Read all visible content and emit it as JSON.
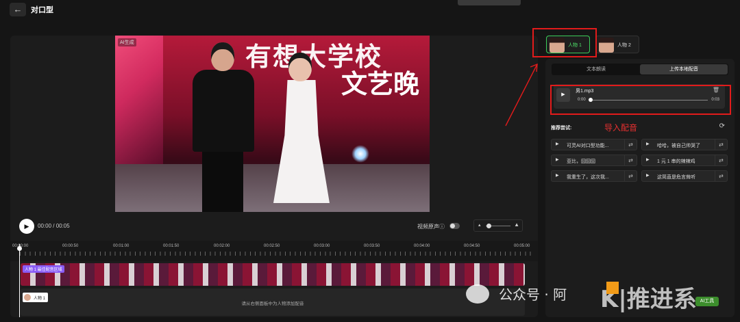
{
  "header": {
    "title": "对口型",
    "back_icon": "←"
  },
  "video": {
    "ai_tag": "AI生成",
    "stage_text_1": "有想大学校",
    "stage_text_2": "文艺晚"
  },
  "player": {
    "play_icon": "▶",
    "time": "00:00 / 00:05",
    "original_sound_label": "视频原声ⓘ",
    "zoom_out_icon": "▴",
    "zoom_in_icon": "▲"
  },
  "timeline": {
    "ticks": [
      "00:00:00",
      "00:00:50",
      "00:01:00",
      "00:01:50",
      "00:02:00",
      "00:02:50",
      "00:03:00",
      "00:03:50",
      "00:04:00",
      "00:04:50",
      "00:05:00"
    ],
    "video_track_label": "人物 1 最佳配音区域",
    "audio_person": "人物 1",
    "audio_hint": "请从右侧面板中为人物添加配音"
  },
  "characters": [
    {
      "label": "人物 1",
      "active": true
    },
    {
      "label": "人物 2",
      "active": false
    }
  ],
  "right_panel": {
    "tabs": [
      "文本朗读",
      "上传本地配音"
    ],
    "active_tab": "上传本地配音",
    "audio_file": {
      "name": "男1.mp3",
      "current": "0:00",
      "duration": "0:03",
      "progress": 0,
      "delete_icon": "🗑"
    },
    "recommend_title": "推荐尝试:",
    "import_annotation": "导入配音",
    "refresh_icon": "⟳",
    "suggestions": [
      "可灵AI对口型功能...",
      "哈哈，被自己帅哭了",
      "亚比，囧囧囧",
      "1 元 1 串的辣辣鸡",
      "我重生了，这次我...",
      "这简直是危言耸听"
    ],
    "play_icon": "▶",
    "swap_icon": "⇄"
  },
  "watermark": {
    "text": "公众号 · 阿",
    "logo": "K|推进系",
    "badge": "AI工具"
  },
  "colors": {
    "accent_green": "#4fe26a",
    "annotation_red": "#e31b1b",
    "track_purple": "#8a5cf6"
  }
}
